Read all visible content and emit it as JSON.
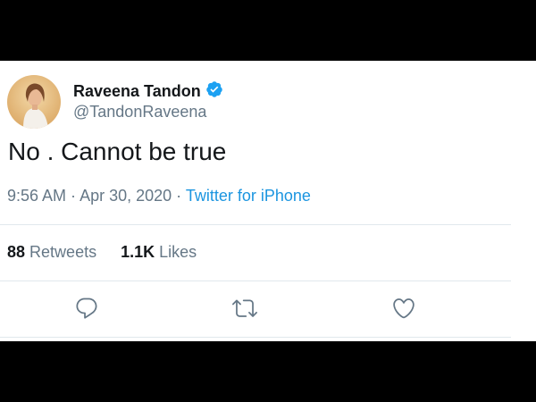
{
  "tweet": {
    "author": {
      "display_name": "Raveena Tandon",
      "handle": "@TandonRaveena",
      "verified": true
    },
    "text": "No . Cannot be true",
    "time": "9:56 AM",
    "separator": " · ",
    "date": "Apr 30, 2020",
    "source": "Twitter for iPhone",
    "stats": {
      "retweets_count": "88",
      "retweets_label": "Retweets",
      "likes_count": "1.1K",
      "likes_label": "Likes"
    },
    "actions": [
      "reply-icon",
      "retweet-icon",
      "like-icon"
    ]
  },
  "colors": {
    "text_primary": "#14171a",
    "text_secondary": "#657786",
    "link_blue": "#1b95e0",
    "verified_blue": "#1da1f2",
    "divider": "#e1e8ed",
    "background": "#ffffff",
    "letterbox": "#000000"
  }
}
